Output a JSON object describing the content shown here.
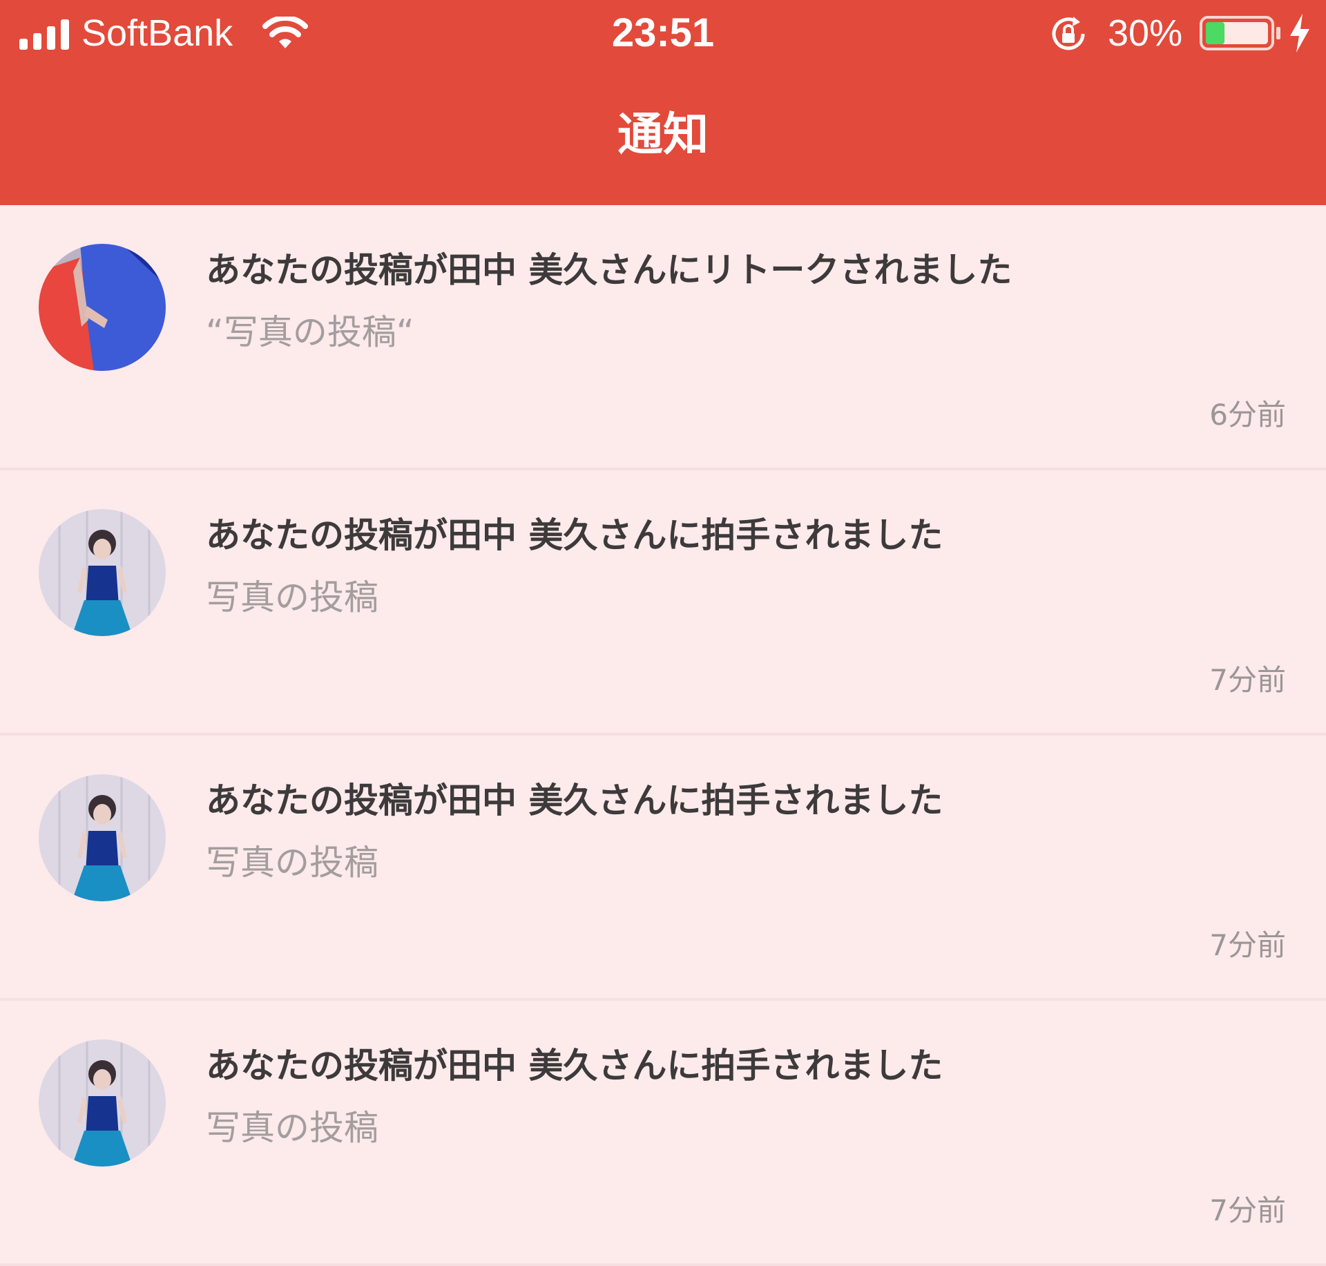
{
  "status_bar": {
    "carrier": "SoftBank",
    "time": "23:51",
    "battery_percent": "30%",
    "battery_level": 0.3,
    "icons": [
      "signal-icon",
      "wifi-icon",
      "rotation-lock-icon",
      "battery-icon",
      "charging-icon"
    ]
  },
  "header": {
    "title": "通知",
    "color": "#e24a3b"
  },
  "notifications": [
    {
      "title": "あなたの投稿が田中 美久さんにリトークされました",
      "subtitle": "“写真の投稿“",
      "time": "6分前",
      "avatar": "hands-photo"
    },
    {
      "title": "あなたの投稿が田中 美久さんに拍手されました",
      "subtitle": "写真の投稿",
      "time": "7分前",
      "avatar": "girl-photo"
    },
    {
      "title": "あなたの投稿が田中 美久さんに拍手されました",
      "subtitle": "写真の投稿",
      "time": "7分前",
      "avatar": "girl-photo"
    },
    {
      "title": "あなたの投稿が田中 美久さんに拍手されました",
      "subtitle": "写真の投稿",
      "time": "7分前",
      "avatar": "girl-photo"
    }
  ]
}
